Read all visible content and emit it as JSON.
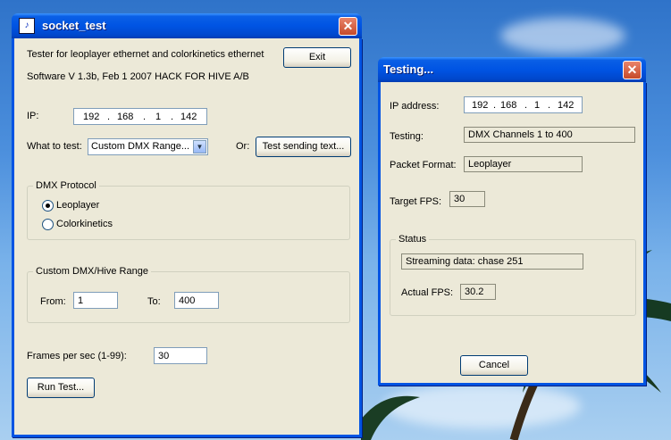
{
  "main_window": {
    "title": "socket_test",
    "description": "Tester for leoplayer ethernet and colorkinetics ethernet",
    "version": "Software V 1.3b,  Feb 1 2007  HACK FOR HIVE A/B",
    "exit_label": "Exit",
    "ip_label": "IP:",
    "ip": [
      "192",
      "168",
      "1",
      "142"
    ],
    "what_to_test_label": "What to test:",
    "what_to_test_value": "Custom DMX Range...",
    "or_label": "Or:",
    "test_sending_label": "Test sending text...",
    "dmx_protocol": {
      "label": "DMX Protocol",
      "options": [
        "Leoplayer",
        "Colorkinetics"
      ],
      "selected": "Leoplayer"
    },
    "custom_range": {
      "label": "Custom DMX/Hive Range",
      "from_label": "From:",
      "from_value": "1",
      "to_label": "To:",
      "to_value": "400"
    },
    "fps_label": "Frames per sec (1-99):",
    "fps_value": "30",
    "run_label": "Run Test..."
  },
  "testing_window": {
    "title": "Testing...",
    "ip_label": "IP address:",
    "ip": [
      "192",
      "168",
      "1",
      "142"
    ],
    "testing_label": "Testing:",
    "testing_value": "DMX Channels 1 to 400",
    "packet_label": "Packet Format:",
    "packet_value": "Leoplayer",
    "target_fps_label": "Target FPS:",
    "target_fps_value": "30",
    "status_label": "Status",
    "status_value": "Streaming data: chase 251",
    "actual_fps_label": "Actual FPS:",
    "actual_fps_value": "30.2",
    "cancel_label": "Cancel"
  },
  "colors": {
    "titlebar": "#0054e3",
    "window_bg": "#ece9d8",
    "close_btn": "#c64a2a"
  }
}
